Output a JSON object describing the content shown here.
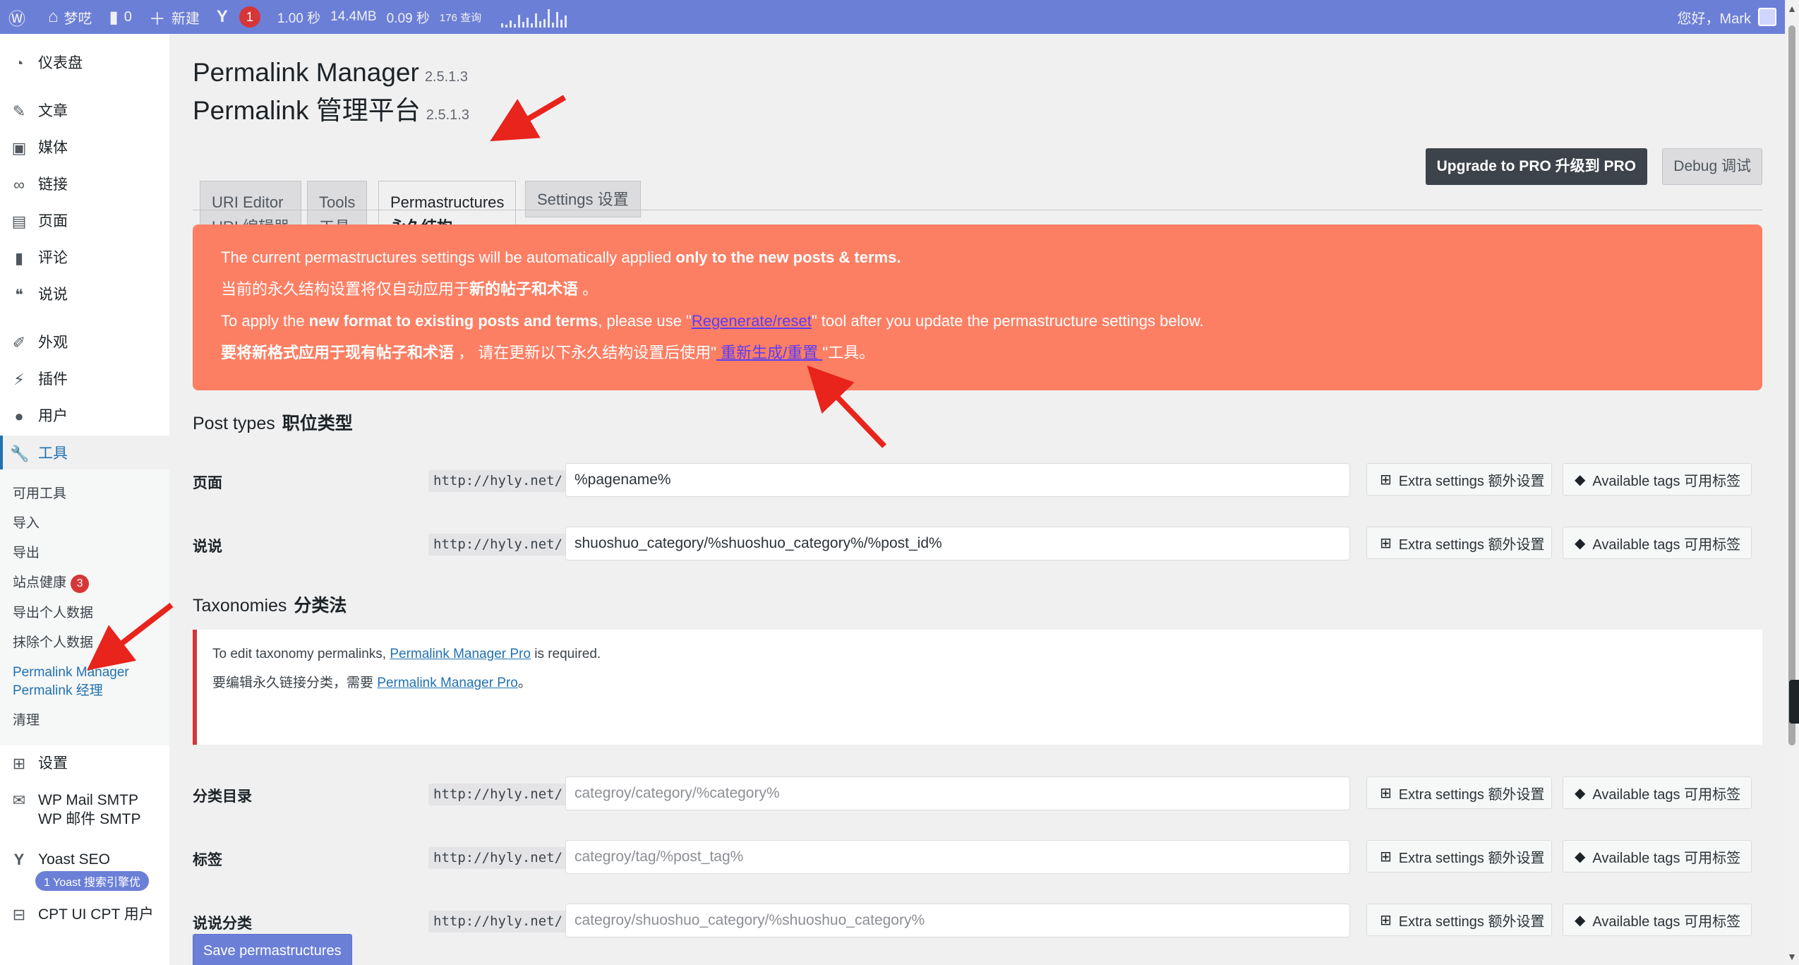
{
  "adminbar": {
    "site_name": "梦呓",
    "comments_count": "0",
    "new_label": "新建",
    "yoast_count": "1",
    "perf_time": "1.00 秒",
    "perf_mem": "14.4MB",
    "perf_db_time": "0.09 秒",
    "perf_queries": "176 查询",
    "greeting": "您好，Mark"
  },
  "sidebar": {
    "dashboard": "仪表盘",
    "posts": "文章",
    "media": "媒体",
    "links": "链接",
    "pages": "页面",
    "comments": "评论",
    "shuoshuo": "说说",
    "appearance": "外观",
    "plugins": "插件",
    "users": "用户",
    "tools": "工具",
    "tools_sub": {
      "available_tools": "可用工具",
      "import": "导入",
      "export": "导出",
      "site_health": "站点健康",
      "site_health_count": "3",
      "export_personal": "导出个人数据",
      "erase_personal": "抹除个人数据",
      "permalink_manager": "Permalink Manager  Permalink 经理",
      "cleanup": "清理"
    },
    "settings": "设置",
    "wp_mail": "WP Mail SMTP  WP 邮件 SMTP",
    "yoast": "Yoast SEO",
    "yoast_badge": "1  Yoast 搜索引擎优",
    "cpt_ui": "CPT UI  CPT 用户"
  },
  "header": {
    "title_en": "Permalink Manager",
    "title_zh": "Permalink 管理平台",
    "version": "2.5.1.3"
  },
  "tabs": [
    {
      "l1": "URI Editor",
      "l2": "URI 编辑器"
    },
    {
      "l1": "Tools",
      "l2": "工具"
    },
    {
      "l1": "Permastructures",
      "l2": "永久结构"
    },
    {
      "l1": "Settings  设置",
      "l2": ""
    }
  ],
  "buttons": {
    "upgrade": "Upgrade to PRO  升级到 PRO",
    "debug": "Debug  调试",
    "save": "Save permastructures",
    "extra_settings": "Extra settings  额外设置",
    "available_tags": "Available tags  可用标签"
  },
  "notice": {
    "line1_pre": "The current permastructures settings will be automatically applied ",
    "line1_bold": "only to the new posts & terms.",
    "line2_pre": "当前的永久结构设置将仅自动应用于",
    "line2_bold": "新的帖子和术语",
    "line2_post": " 。",
    "line3_pre": "To apply the ",
    "line3_bold": "new format to existing posts and terms",
    "line3_mid": ", please use \"",
    "line3_link": "Regenerate/reset",
    "line3_post": "\" tool after you update the permastructure settings below.",
    "line4_bold": "要将新格式应用于现有帖子和术语",
    "line4_mid": " ， 请在更新以下永久结构设置后使用\"",
    "line4_link": " 重新生成/重置 ",
    "line4_post": "\"工具。"
  },
  "post_types": {
    "heading_en": "Post types",
    "heading_zh": "职位类型",
    "rows": [
      {
        "label": "页面",
        "prefix": "http://hyly.net/",
        "value": "%pagename%"
      },
      {
        "label": "说说",
        "prefix": "http://hyly.net/",
        "value": "shuoshuo_category/%shuoshuo_category%/%post_id%"
      }
    ]
  },
  "taxonomies": {
    "heading_en": "Taxonomies",
    "heading_zh": "分类法",
    "pro_notice_pre": "To edit taxonomy permalinks, ",
    "pro_notice_link": "Permalink Manager Pro",
    "pro_notice_post": " is required.",
    "pro_notice_zh_pre": "要编辑永久链接分类，需要 ",
    "pro_notice_zh_link": "Permalink Manager Pro",
    "pro_notice_zh_post": "。",
    "rows": [
      {
        "label": "分类目录",
        "prefix": "http://hyly.net/",
        "placeholder": "categroy/category/%category%"
      },
      {
        "label": "标签",
        "prefix": "http://hyly.net/",
        "placeholder": "categroy/tag/%post_tag%"
      },
      {
        "label": "说说分类",
        "prefix": "http://hyly.net/",
        "placeholder": "categroy/shuoshuo_category/%shuoshuo_category%"
      }
    ]
  },
  "colors": {
    "adminbar": "#6b7fd7",
    "notice_orange": "#fc7f64",
    "annotation_arrow": "#e8241c",
    "error_border": "#d63638"
  }
}
